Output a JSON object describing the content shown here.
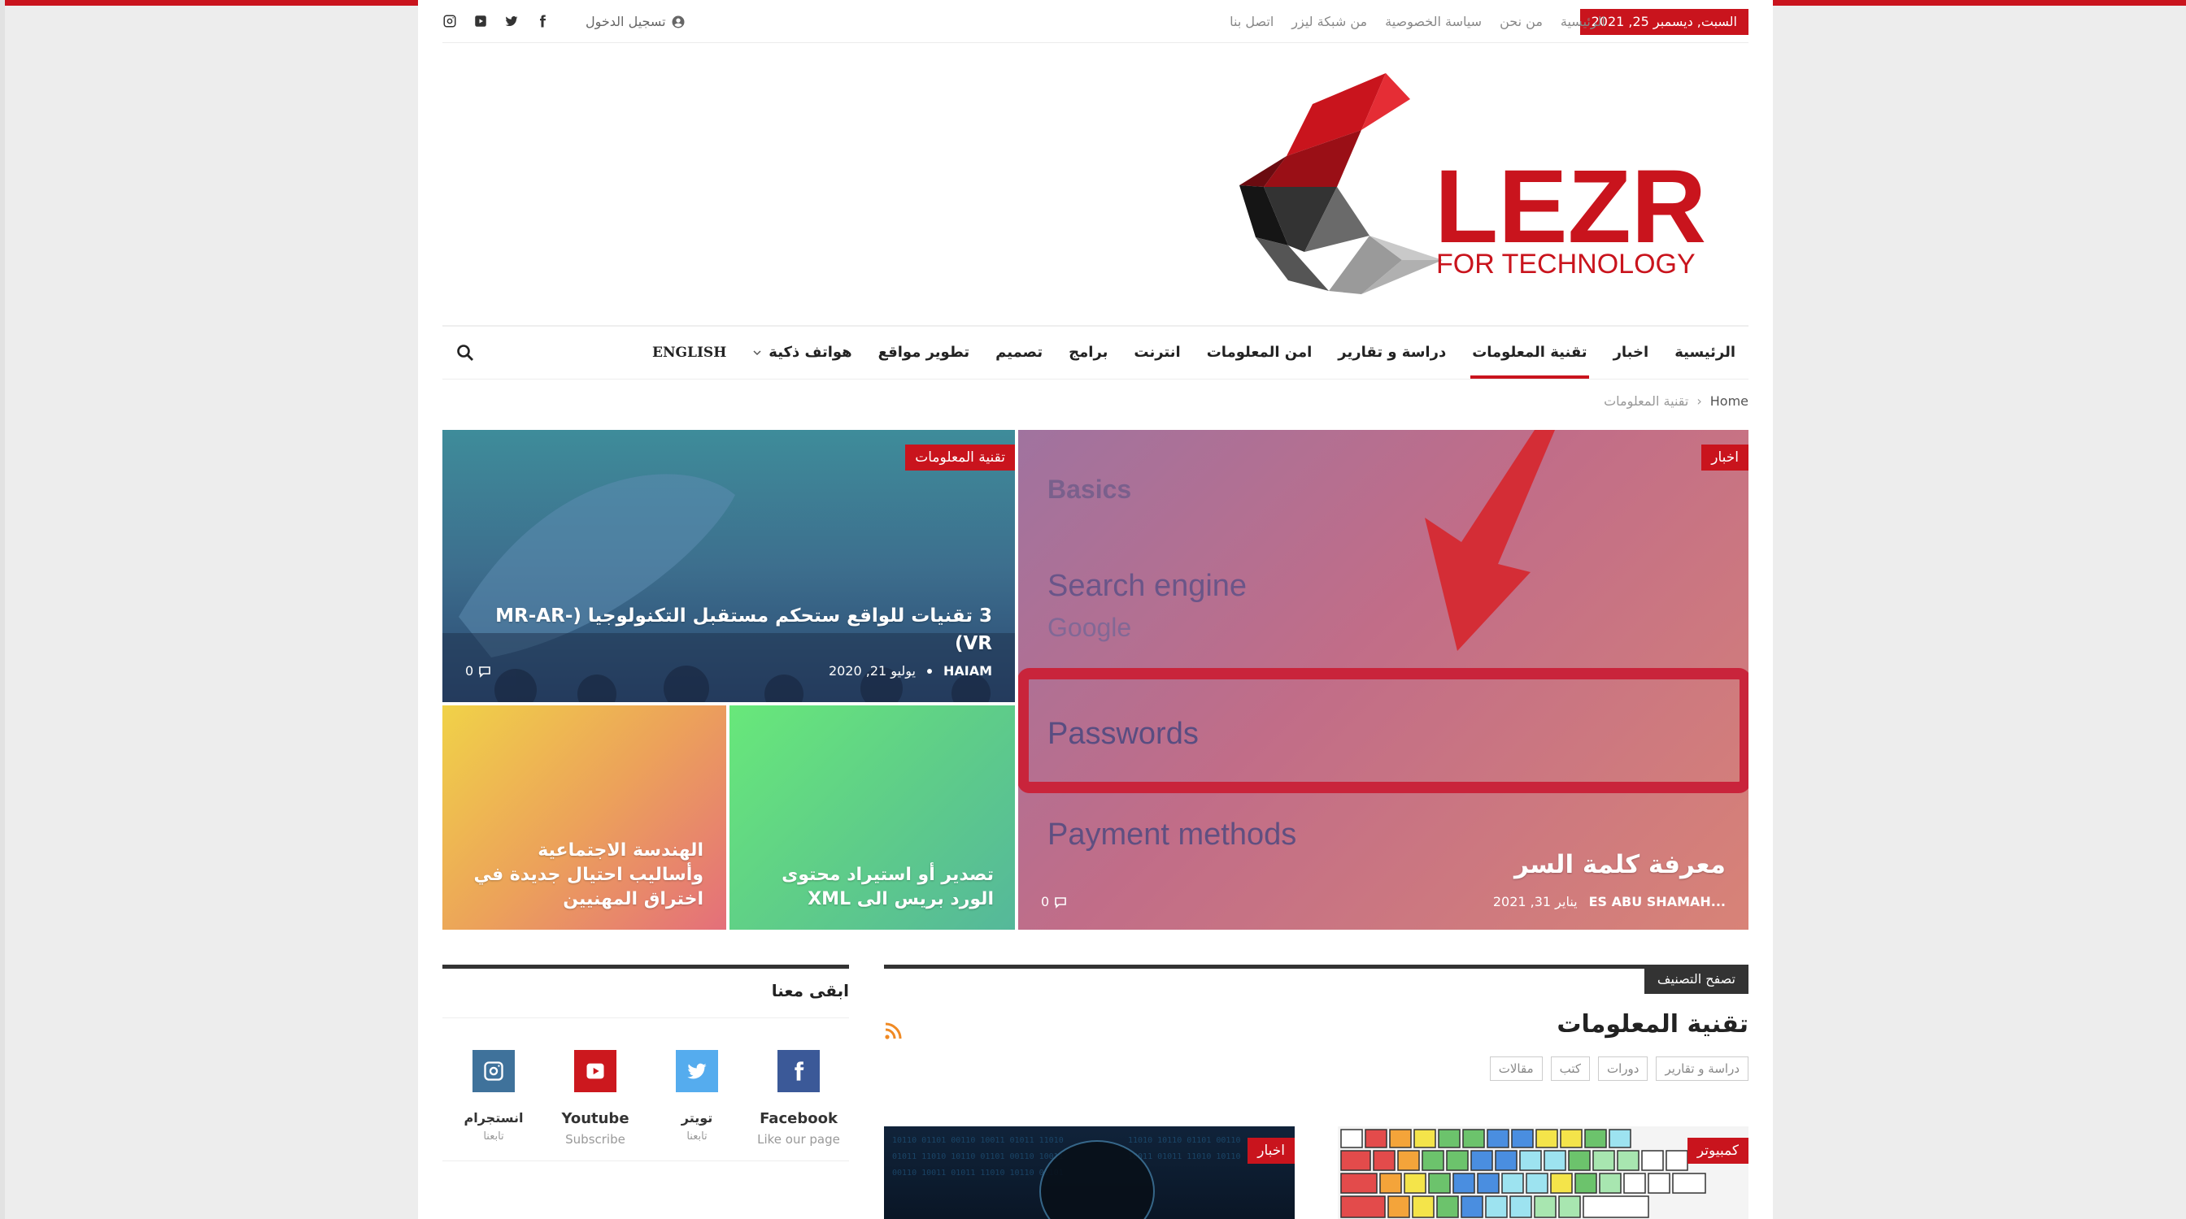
{
  "topbar": {
    "date": "السبت, ديسمبر 25, 2021",
    "links": [
      "الرئيسية",
      "من نحن",
      "سياسة الخصوصية",
      "من شبكة ليزر",
      "اتصل بنا"
    ],
    "login": "تسجيل الدخول",
    "social_icons": [
      "instagram-icon",
      "youtube-icon",
      "twitter-icon",
      "facebook-icon"
    ]
  },
  "logo": {
    "title": "LEZR",
    "subtitle": "FOR TECHNOLOGY",
    "colors": {
      "brand": "#c9141d",
      "dark": "#111111"
    }
  },
  "nav": {
    "items": [
      {
        "label": "الرئيسية"
      },
      {
        "label": "اخبار"
      },
      {
        "label": "تقنية المعلومات",
        "active": true
      },
      {
        "label": "دراسة و تقارير"
      },
      {
        "label": "امن المعلومات"
      },
      {
        "label": "انترنت"
      },
      {
        "label": "برامج"
      },
      {
        "label": "تصميم"
      },
      {
        "label": "تطوير مواقع"
      },
      {
        "label": "هواتف ذكية",
        "has_dropdown": true
      },
      {
        "label": "ENGLISH"
      }
    ],
    "search_icon": "search-icon"
  },
  "breadcrumb": {
    "home": "Home",
    "current": "تقنية المعلومات"
  },
  "featured": {
    "main": {
      "category": "اخبار",
      "title": "معرفة كلمة السر",
      "author": "ES ABU SHAMAH...",
      "date": "يناير 31, 2021",
      "comments": "0",
      "image_texts": {
        "t1": "Basics",
        "t2": "Search engine",
        "t3": "Google",
        "t4": "Passwords",
        "t5": "Payment methods"
      }
    },
    "top_left": {
      "category": "تقنية المعلومات",
      "title": "3 تقنيات للواقع ستحكم مستقبل التكنولوجيا (-MR-AR VR)",
      "author": "HAIAM",
      "date": "يوليو 21, 2020",
      "comments": "0"
    },
    "bottom_mid": {
      "title": "تصدير أو استيراد محتوى الورد بريس الى XML"
    },
    "bottom_left": {
      "title": "الهندسة الاجتماعية وأساليب احتيال جديدة في اختراق المهنيين"
    }
  },
  "stay_with_us": {
    "title": "ابقى معنا",
    "items": [
      {
        "name": "Facebook",
        "sub": "Like our page",
        "icon": "facebook-icon",
        "color": "#3b5998"
      },
      {
        "name": "تويتر",
        "sub": "تابعنا",
        "icon": "twitter-icon",
        "color": "#55acee"
      },
      {
        "name": "Youtube",
        "sub": "Subscribe",
        "icon": "youtube-icon",
        "color": "#cc181e"
      },
      {
        "name": "انستجرام",
        "sub": "تابعنا",
        "icon": "instagram-icon",
        "color": "#3f729b"
      }
    ]
  },
  "category_section": {
    "badge": "تصفح التصنيف",
    "title": "تقنية المعلومات",
    "rss_icon": "rss-icon",
    "tags": [
      "دراسة و تقارير",
      "دورات",
      "كتب",
      "مقالات"
    ],
    "posts": [
      {
        "category": "كمبيوتر"
      },
      {
        "category": "اخبار"
      }
    ]
  }
}
